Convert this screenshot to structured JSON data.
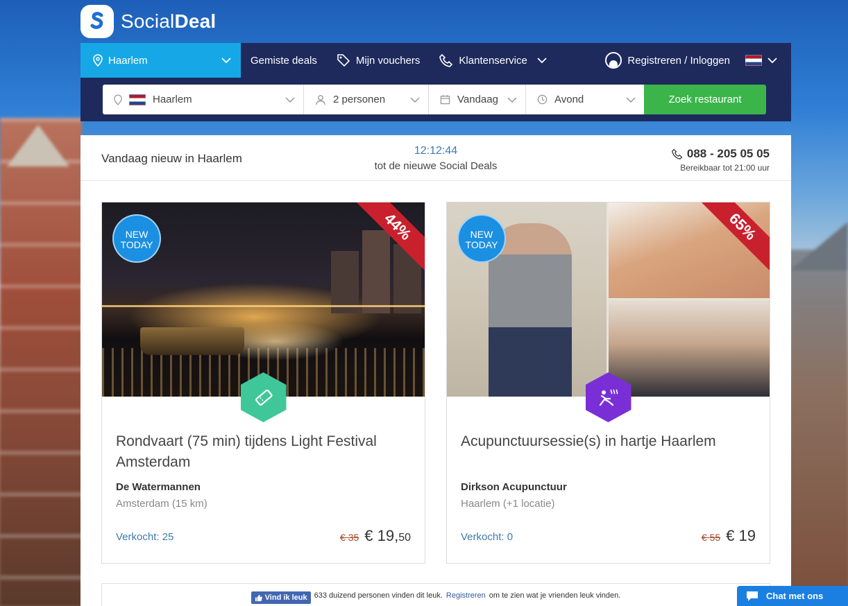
{
  "brand": {
    "name_light": "Social",
    "name_bold": "Deal"
  },
  "nav": {
    "city": "Haarlem",
    "links": [
      "Gemiste deals",
      "Mijn vouchers",
      "Klantenservice"
    ],
    "login": "Registreren / Inloggen"
  },
  "search": {
    "city": "Haarlem",
    "persons": "2 personen",
    "date": "Vandaag",
    "time": "Avond",
    "button": "Zoek restaurant"
  },
  "header": {
    "new_in": "Vandaag nieuw in Haarlem",
    "clock": "12:12:44",
    "clock_sub": "tot de nieuwe Social Deals",
    "phone": "088 - 205 05 05",
    "availability": "Bereikbaar tot 21:00 uur"
  },
  "deals": [
    {
      "badge": "NEW TODAY",
      "discount": "44%",
      "title": "Rondvaart (75 min) tijdens Light Festival Amsterdam",
      "merchant": "De Watermannen",
      "location": "Amsterdam (15 km)",
      "sold": "Verkocht: 25",
      "old_price": "€ 35",
      "price_main": "€ 19,",
      "price_cents": "50",
      "category_icon": "ticket-icon",
      "category_color": "#3fc79a"
    },
    {
      "badge": "NEW TODAY",
      "discount": "65%",
      "title": "Acupunctuursessie(s) in hartje Haarlem",
      "merchant": "Dirkson Acupunctuur",
      "location": "Haarlem (+1 locatie)",
      "sold": "Verkocht: 0",
      "old_price": "€ 55",
      "price_main": "€ 19",
      "price_cents": "",
      "category_icon": "wellness-icon",
      "category_color": "#7a2fd6"
    }
  ],
  "facebook": {
    "button": "Vind ik leuk",
    "text1": "633 duizend personen vinden dit leuk.",
    "link": "Registreren",
    "text2": "om te zien wat je vrienden leuk vinden."
  },
  "chat": {
    "label": "Chat met ons"
  },
  "colors": {
    "nav": "#1e2a5c",
    "accent": "#16a8e6",
    "cta": "#3bb54a",
    "ribbon": "#c9202d"
  }
}
